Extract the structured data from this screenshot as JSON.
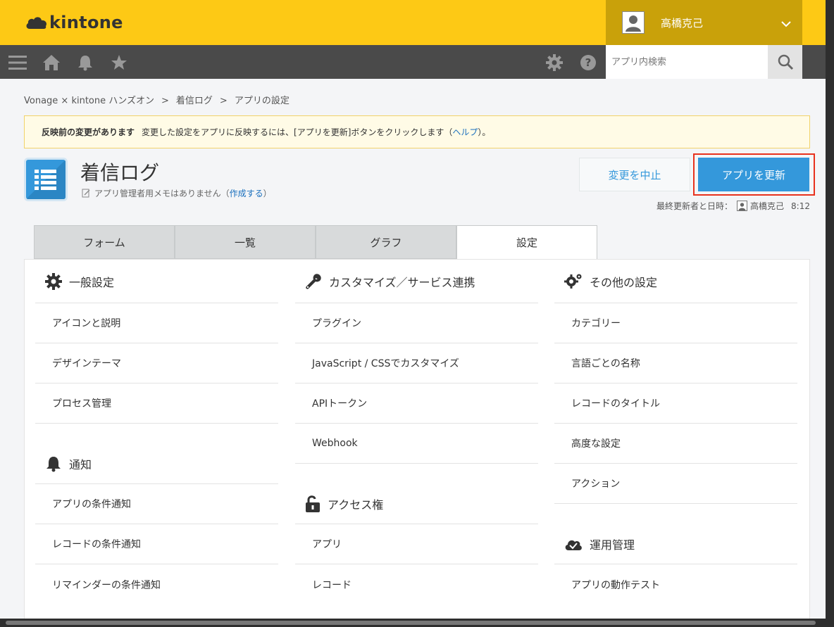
{
  "app_name": "kintone",
  "user": {
    "name": "高橋克己"
  },
  "search": {
    "placeholder": "アプリ内検索"
  },
  "breadcrumb": {
    "items": [
      "Vonage × kintone ハンズオン",
      "着信ログ",
      "アプリの設定"
    ],
    "separator": ">"
  },
  "notice": {
    "bold": "反映前の変更があります",
    "text_before": "変更した設定をアプリに反映するには、[アプリを更新]ボタンをクリックします（",
    "link": "ヘルプ",
    "text_after": "）。"
  },
  "app": {
    "title": "着信ログ",
    "memo_text": "アプリ管理者用メモはありません（",
    "memo_link": "作成する",
    "memo_end": "）"
  },
  "buttons": {
    "cancel": "変更を中止",
    "update": "アプリを更新"
  },
  "last_update": {
    "label": "最終更新者と日時：",
    "user": "高橋克己",
    "time": "8:12"
  },
  "tabs": [
    {
      "label": "フォーム"
    },
    {
      "label": "一覧"
    },
    {
      "label": "グラフ"
    },
    {
      "label": "設定",
      "active": true
    }
  ],
  "columns": {
    "general": {
      "title": "一般設定",
      "icon": "gear-icon",
      "items": [
        "アイコンと説明",
        "デザインテーマ",
        "プロセス管理"
      ]
    },
    "notify": {
      "title": "通知",
      "icon": "bell-icon",
      "items": [
        "アプリの条件通知",
        "レコードの条件通知",
        "リマインダーの条件通知"
      ]
    },
    "custom": {
      "title": "カスタマイズ／サービス連携",
      "icon": "wrench-icon",
      "items": [
        "プラグイン",
        "JavaScript / CSSでカスタマイズ",
        "APIトークン",
        "Webhook"
      ]
    },
    "access": {
      "title": "アクセス権",
      "icon": "lock-open-icon",
      "items": [
        "アプリ",
        "レコード"
      ]
    },
    "other": {
      "title": "その他の設定",
      "icon": "gears-icon",
      "items": [
        "カテゴリー",
        "言語ごとの名称",
        "レコードのタイトル",
        "高度な設定",
        "アクション"
      ]
    },
    "ops": {
      "title": "運用管理",
      "icon": "cloud-check-icon",
      "items": [
        "アプリの動作テスト"
      ]
    }
  },
  "colors": {
    "header": "#fdc915",
    "toolbar": "#4a4a4a",
    "accent": "#3498db",
    "highlight": "#e8321e"
  }
}
